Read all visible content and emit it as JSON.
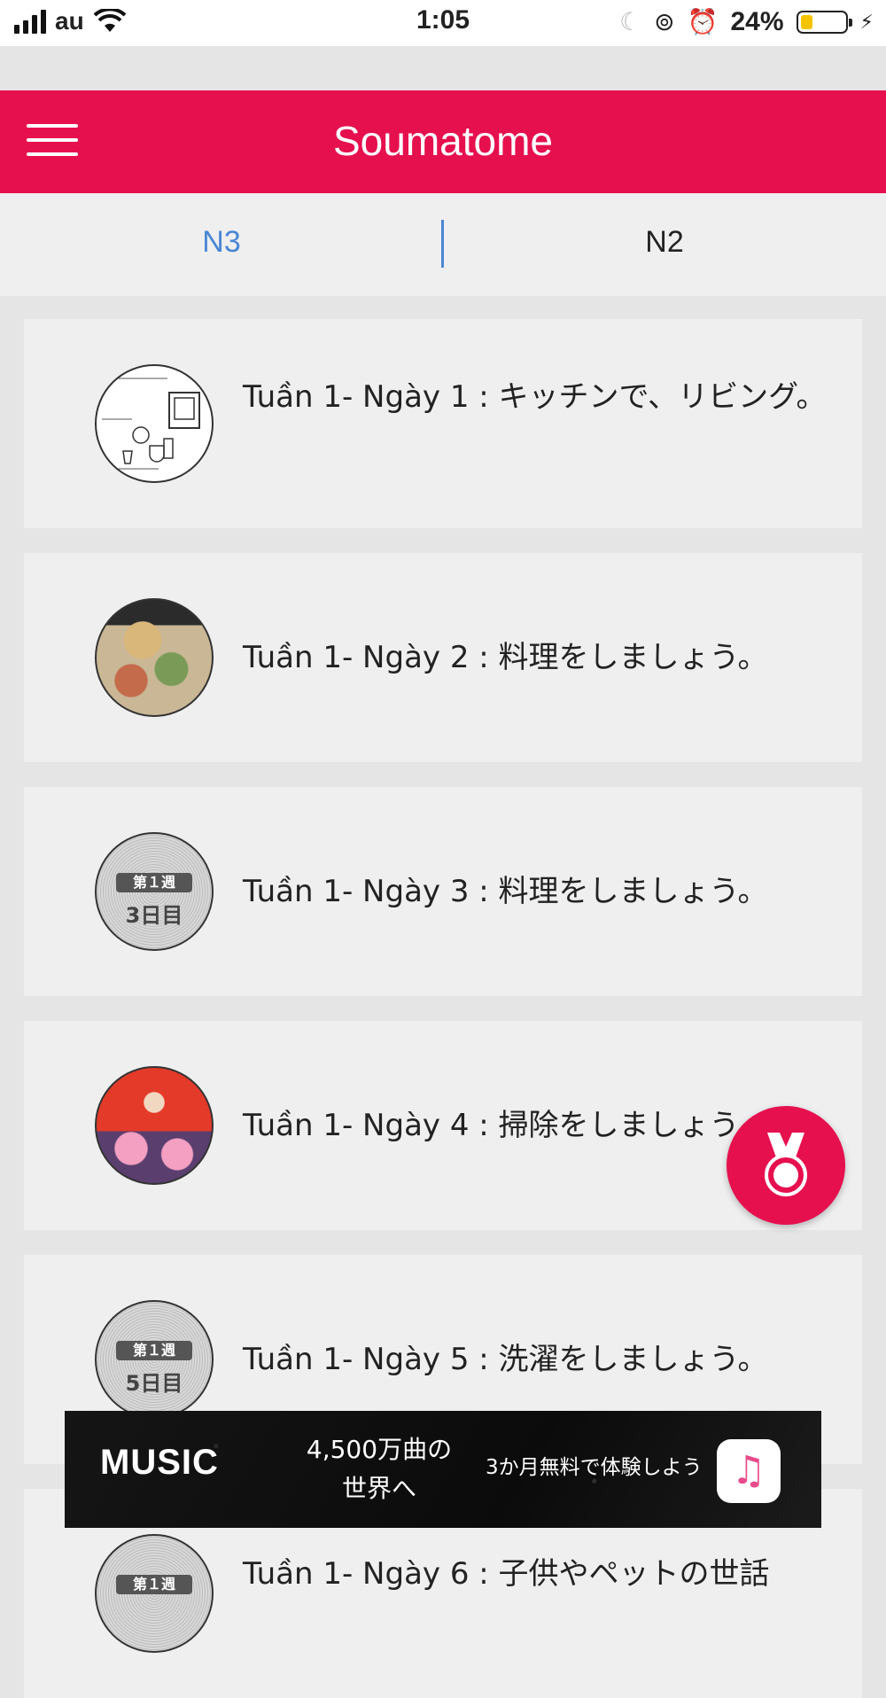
{
  "status_bar": {
    "carrier": "au",
    "time": "1:05",
    "battery_percent": "24%",
    "battery_level": 0.24
  },
  "header": {
    "title": "Soumatome"
  },
  "tabs": [
    {
      "label": "N3",
      "active": true
    },
    {
      "label": "N2",
      "active": false
    }
  ],
  "lessons": [
    {
      "title": "Tuần 1- Ngày 1 : キッチンで、リビング。",
      "thumbnail": "kitchen-illustration"
    },
    {
      "title": "Tuần 1- Ngày 2 : 料理をしましょう。",
      "thumbnail": "food-photo"
    },
    {
      "title": "Tuần 1- Ngày 3 : 料理をしましょう。",
      "thumbnail": "week-day-badge",
      "badge_top": "第１週",
      "badge_bottom": "3日目"
    },
    {
      "title": "Tuần 1- Ngày 4 : 掃除をしましょう。",
      "thumbnail": "doll-photo"
    },
    {
      "title": "Tuần 1- Ngày 5 : 洗濯をしましょう。",
      "thumbnail": "week-day-badge",
      "badge_top": "第１週",
      "badge_bottom": "5日目"
    },
    {
      "title": "Tuần 1- Ngày 6 : 子供やペットの世話",
      "thumbnail": "week-day-badge",
      "badge_top": "第１週",
      "badge_bottom": ""
    }
  ],
  "fab": {
    "icon": "medal-icon"
  },
  "ad": {
    "brand": "MUSIC",
    "headline": "4,500万曲の世界へ",
    "cta": "3か月無料で体験しよう",
    "app_icon": "music-note-icon"
  },
  "colors": {
    "accent": "#e6104f",
    "tab_active": "#4a86d4"
  }
}
